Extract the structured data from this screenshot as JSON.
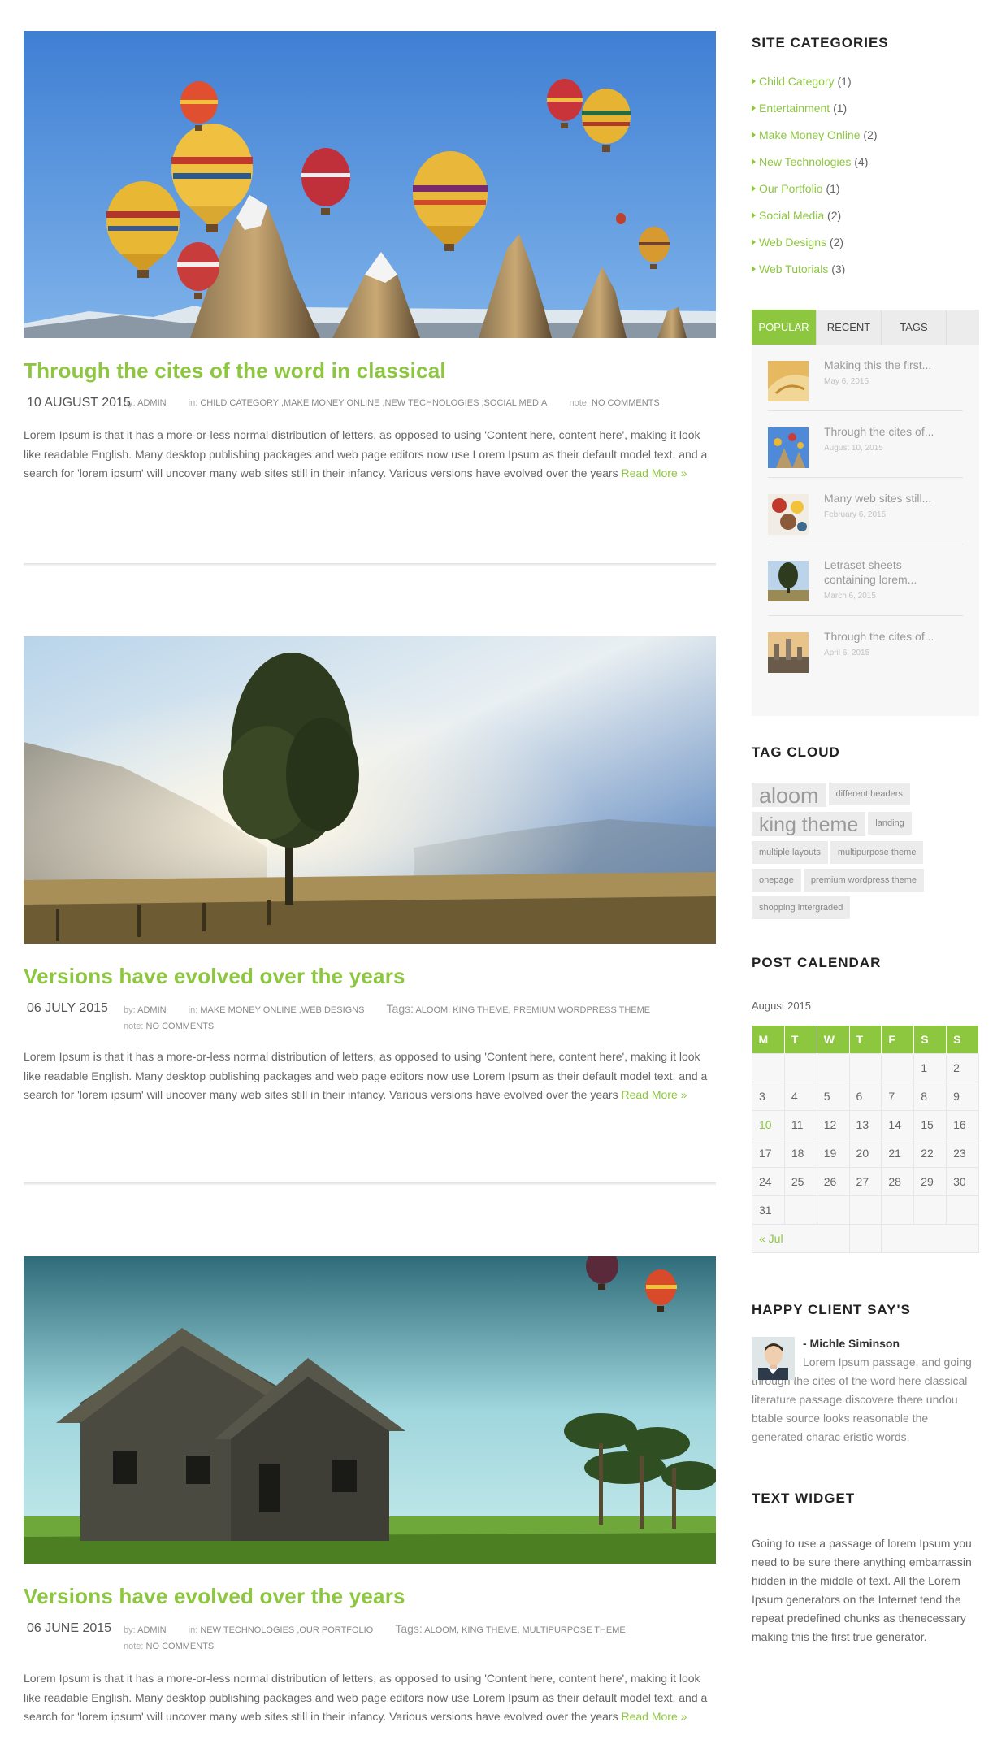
{
  "posts": [
    {
      "title": "Through the cites of the word in classical",
      "date": "10 AUGUST 2015",
      "by_label": "by:",
      "author": "ADMIN",
      "in_label": "in:",
      "categories": "CHILD CATEGORY ,MAKE MONEY ONLINE ,NEW TECHNOLOGIES ,SOCIAL MEDIA",
      "note_label": "note:",
      "comments": "NO COMMENTS",
      "excerpt": "Lorem Ipsum is that it has a more-or-less normal distribution of letters, as opposed to using 'Content here, content here', making it look like readable English. Many desktop publishing packages and web page editors now use Lorem Ipsum as their default model text, and a search for 'lorem ipsum' will uncover many web sites still in their infancy. Various versions have evolved over the years",
      "read_more": "Read More »",
      "image": "hot-air-balloons-over-rock-spires"
    },
    {
      "title": "Versions have evolved over the years",
      "date": "06 JULY 2015",
      "by_label": "by:",
      "author": "ADMIN",
      "in_label": "in:",
      "categories": "MAKE MONEY ONLINE ,WEB DESIGNS",
      "tags_label": "Tags:",
      "tags": "ALOOM, KING THEME, PREMIUM WORDPRESS THEME",
      "note_label": "note:",
      "comments": "NO COMMENTS",
      "excerpt": "Lorem Ipsum is that it has a more-or-less normal distribution of letters, as opposed to using 'Content here, content here', making it look like readable English. Many desktop publishing packages and web page editors now use Lorem Ipsum as their default model text, and a search for 'lorem ipsum' will uncover many web sites still in their infancy. Various versions have evolved over the years",
      "read_more": "Read More »",
      "image": "misty-meadow-with-tree"
    },
    {
      "title": "Versions have evolved over the years",
      "date": "06 JUNE 2015",
      "by_label": "by:",
      "author": "ADMIN",
      "in_label": "in:",
      "categories": "NEW TECHNOLOGIES ,OUR PORTFOLIO",
      "tags_label": "Tags:",
      "tags": "ALOOM, KING THEME, MULTIPURPOSE THEME",
      "note_label": "note:",
      "comments": "NO COMMENTS",
      "excerpt": "Lorem Ipsum is that it has a more-or-less normal distribution of letters, as opposed to using 'Content here, content here', making it look like readable English. Many desktop publishing packages and web page editors now use Lorem Ipsum as their default model text, and a search for 'lorem ipsum' will uncover many web sites still in their infancy. Various versions have evolved over the years",
      "read_more": "Read More »",
      "image": "old-wooden-house-with-palms"
    }
  ],
  "sidebar": {
    "categories_title": "SITE CATEGORIES",
    "categories": [
      {
        "name": "Child Category",
        "count": "(1)"
      },
      {
        "name": "Entertainment",
        "count": "(1)"
      },
      {
        "name": "Make Money Online",
        "count": "(2)"
      },
      {
        "name": "New Technologies",
        "count": "(4)"
      },
      {
        "name": "Our Portfolio",
        "count": "(1)"
      },
      {
        "name": "Social Media",
        "count": "(2)"
      },
      {
        "name": "Web Designs",
        "count": "(2)"
      },
      {
        "name": "Web Tutorials",
        "count": "(3)"
      }
    ],
    "tabs": [
      "POPULAR",
      "RECENT",
      "TAGS"
    ],
    "tab_items": [
      {
        "title": "Making this the first...",
        "date": "May 6, 2015"
      },
      {
        "title": "Through the cites of...",
        "date": "August 10, 2015"
      },
      {
        "title": "Many web sites still...",
        "date": "February 6, 2015"
      },
      {
        "title": "Letraset sheets containing lorem...",
        "date": "March 6, 2015"
      },
      {
        "title": "Through the cites of...",
        "date": "April 6, 2015"
      }
    ],
    "tag_cloud_title": "TAG CLOUD",
    "tag_cloud": [
      "aloom",
      "different headers",
      "king theme",
      "landing",
      "multiple layouts",
      "multipurpose theme",
      "onepage",
      "premium wordpress theme",
      "shopping intergraded"
    ],
    "calendar_title": "POST CALENDAR",
    "calendar": {
      "caption": "August 2015",
      "days": [
        "M",
        "T",
        "W",
        "T",
        "F",
        "S",
        "S"
      ],
      "rows": [
        [
          "",
          "",
          "",
          "",
          "",
          "1",
          "2"
        ],
        [
          "3",
          "4",
          "5",
          "6",
          "7",
          "8",
          "9"
        ],
        [
          "10",
          "11",
          "12",
          "13",
          "14",
          "15",
          "16"
        ],
        [
          "17",
          "18",
          "19",
          "20",
          "21",
          "22",
          "23"
        ],
        [
          "24",
          "25",
          "26",
          "27",
          "28",
          "29",
          "30"
        ],
        [
          "31",
          "",
          "",
          "",
          "",
          "",
          ""
        ]
      ],
      "prev_link": "« Jul",
      "highlight": "10"
    },
    "client_title": "HAPPY CLIENT SAY'S",
    "client": {
      "name": "- Michle Siminson",
      "text": "Lorem Ipsum passage, and going through the cites of the word here classical literature passage discovere there undou btable source looks reasonable the generated charac eristic words."
    },
    "text_widget_title": "TEXT WIDGET",
    "text_widget": "Going to use a passage of lorem Ipsum you need to be sure there anything embarrassin hidden in the middle of text. All the Lorem Ipsum generators on the Internet tend the repeat predefined chunks as thenecessary making this the first true generator."
  },
  "colors": {
    "accent": "#8dc63f",
    "text": "#666666",
    "heading": "#222222"
  }
}
